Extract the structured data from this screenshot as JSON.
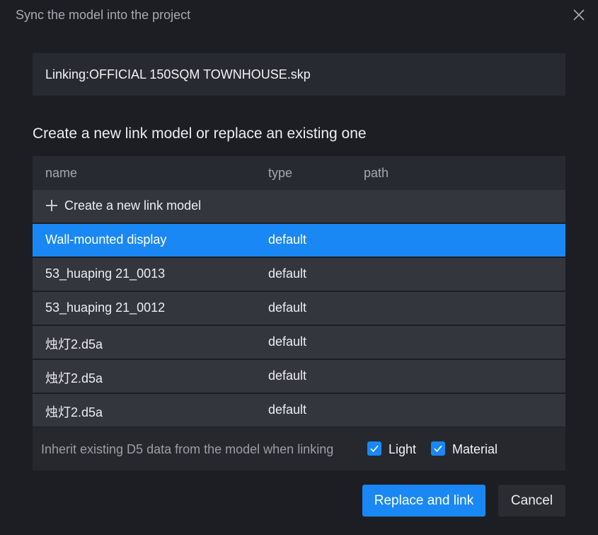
{
  "dialog": {
    "title": "Sync the model into the project",
    "linking_text": "Linking:OFFICIAL 150SQM TOWNHOUSE.skp",
    "section_heading": "Create a new link model or replace an existing one"
  },
  "table": {
    "headers": {
      "name": "name",
      "type": "type",
      "path": "path"
    },
    "create_label": "Create a new link model",
    "rows": [
      {
        "name": "Wall-mounted display",
        "type": "default",
        "path": "",
        "selected": true
      },
      {
        "name": "53_huaping 21_0013",
        "type": "default",
        "path": ""
      },
      {
        "name": "53_huaping 21_0012",
        "type": "default",
        "path": ""
      },
      {
        "name": "烛灯2.d5a",
        "type": "default",
        "path": ""
      },
      {
        "name": "烛灯2.d5a",
        "type": "default",
        "path": ""
      },
      {
        "name": "烛灯2.d5a",
        "type": "default",
        "path": ""
      }
    ]
  },
  "inherit": {
    "label": "Inherit existing D5 data from the model when linking",
    "options": [
      {
        "label": "Light",
        "checked": true
      },
      {
        "label": "Material",
        "checked": true
      }
    ]
  },
  "buttons": {
    "primary": "Replace and link",
    "cancel": "Cancel"
  },
  "colors": {
    "accent": "#1a88f4",
    "background": "#1c1e24",
    "row": "#33363c",
    "panel": "#282a31"
  },
  "icons": [
    "close-icon",
    "plus-icon",
    "checkmark-icon"
  ]
}
